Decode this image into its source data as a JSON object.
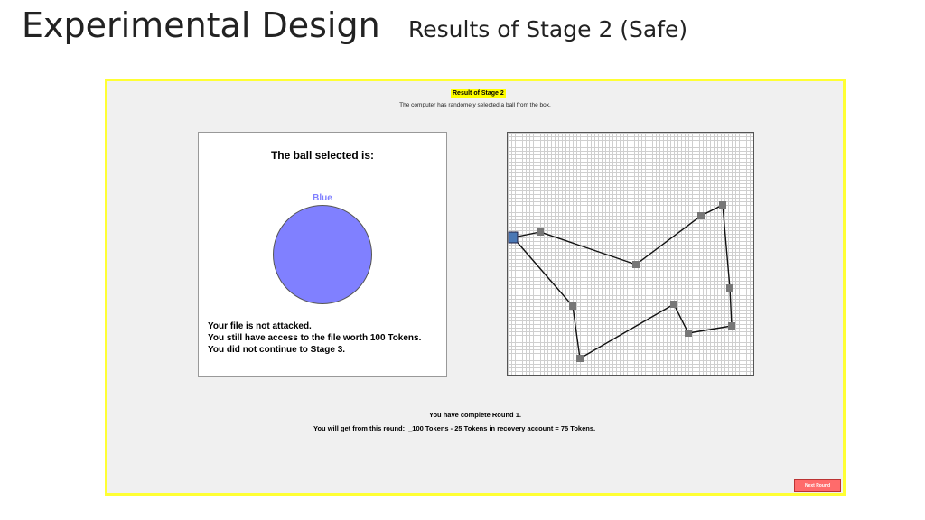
{
  "slide": {
    "title": "Experimental Design",
    "subtitle": "Results of Stage 2 (Safe)"
  },
  "screen": {
    "heading": "Result of Stage 2",
    "note": "The computer has randomely selected a ball from the box.",
    "ball_panel": {
      "heading": "The ball selected is:",
      "color_name": "Blue",
      "ball_color": "#8080ff",
      "lines": [
        "Your file is not attacked.",
        "You still have access to the file worth 100 Tokens.",
        "You did not continue to Stage 3."
      ]
    },
    "round": {
      "complete_text": "You have complete Round 1.",
      "earnings_label": "You will get from this round:",
      "earnings_value": "_100 Tokens - 25 Tokens in recovery account = 75 Tokens."
    },
    "next_button_label": "Next Round"
  }
}
